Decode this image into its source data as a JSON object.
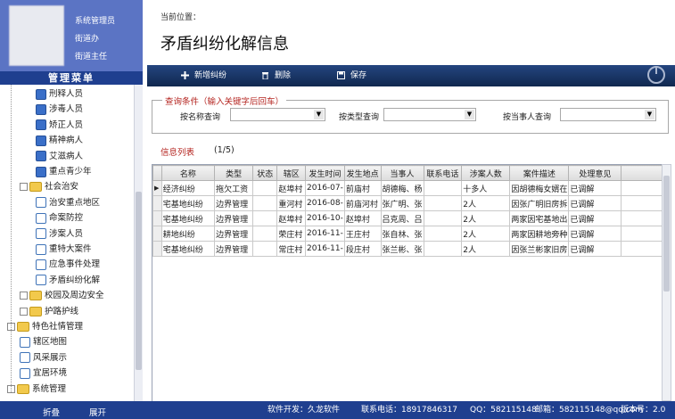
{
  "profile": {
    "roles": [
      "系统管理员",
      "街道办",
      "街道主任"
    ]
  },
  "menu": {
    "title": "管理菜单",
    "items": [
      {
        "label": "刑释人员",
        "level": 2,
        "icon": "person-icon"
      },
      {
        "label": "涉毒人员",
        "level": 2,
        "icon": "person-icon"
      },
      {
        "label": "矫正人员",
        "level": 2,
        "icon": "person-icon"
      },
      {
        "label": "精神病人",
        "level": 2,
        "icon": "person-icon"
      },
      {
        "label": "艾滋病人",
        "level": 2,
        "icon": "person-icon"
      },
      {
        "label": "重点青少年",
        "level": 2,
        "icon": "person-icon"
      },
      {
        "label": "社会治安",
        "level": 1,
        "icon": "folder-icon",
        "expander": "-"
      },
      {
        "label": "治安重点地区",
        "level": 2,
        "icon": "document-icon"
      },
      {
        "label": "命案防控",
        "level": 2,
        "icon": "document-icon"
      },
      {
        "label": "涉案人员",
        "level": 2,
        "icon": "document-icon"
      },
      {
        "label": "重特大案件",
        "level": 2,
        "icon": "document-icon"
      },
      {
        "label": "应急事件处理",
        "level": 2,
        "icon": "document-icon"
      },
      {
        "label": "矛盾纠纷化解",
        "level": 2,
        "icon": "document-icon"
      },
      {
        "label": "校园及周边安全",
        "level": 1,
        "icon": "folder-icon",
        "expander": "+"
      },
      {
        "label": "护路护线",
        "level": 1,
        "icon": "folder-icon",
        "expander": "+"
      },
      {
        "label": "特色社情管理",
        "level": 0,
        "icon": "folder-icon",
        "expander": "-"
      },
      {
        "label": "辖区地图",
        "level": 1,
        "icon": "map-icon"
      },
      {
        "label": "风采展示",
        "level": 1,
        "icon": "map-icon"
      },
      {
        "label": "宜居环境",
        "level": 1,
        "icon": "map-icon"
      },
      {
        "label": "系统管理",
        "level": 0,
        "icon": "folder-icon",
        "expander": "+"
      }
    ],
    "collapse_label": "折叠",
    "expand_label": "展开"
  },
  "breadcrumb": "当前位置：",
  "page_title": "矛盾纠纷化解信息",
  "toolbar": {
    "add_label": "新增纠纷",
    "delete_label": "删除",
    "save_label": "保存"
  },
  "query": {
    "legend": "查询条件（输入关键字后回车）",
    "filters": [
      {
        "label": "按名称查询",
        "value": ""
      },
      {
        "label": "按类型查询",
        "value": ""
      },
      {
        "label": "按当事人查询",
        "value": ""
      }
    ]
  },
  "list": {
    "title": "信息列表",
    "count": "(1/5)"
  },
  "table": {
    "columns": [
      "名称",
      "类型",
      "状态",
      "辖区",
      "发生时间",
      "发生地点",
      "当事人",
      "联系电话",
      "涉案人数",
      "案件描述",
      "处理意见"
    ],
    "rows": [
      [
        "经济纠纷",
        "拖欠工资",
        "",
        "赵埠村",
        "2016-07-",
        "前庙村",
        "胡德梅、杨",
        "",
        "十多人",
        "因胡德梅女婿在",
        "已调解"
      ],
      [
        "宅基地纠纷",
        "边界管理",
        "",
        "重河村",
        "2016-08-",
        "前庙河村",
        "张广明、张",
        "",
        "2人",
        "因张广明旧房拆",
        "已调解"
      ],
      [
        "宅基地纠纷",
        "边界管理",
        "",
        "赵埠村",
        "2016-10-",
        "赵埠村",
        "吕克周、吕",
        "",
        "2人",
        "两家因宅基地出",
        "已调解"
      ],
      [
        "耕地纠纷",
        "边界管理",
        "",
        "荣庄村",
        "2016-11-",
        "王庄村",
        "张自林、张",
        "",
        "2人",
        "两家因耕地旁种",
        "已调解"
      ],
      [
        "宅基地纠纷",
        "边界管理",
        "",
        "常庄村",
        "2016-11-",
        "段庄村",
        "张兰彬、张",
        "",
        "2人",
        "因张兰彬家旧房",
        "已调解"
      ]
    ],
    "current_row_marker": "▶"
  },
  "status": {
    "developer": "软件开发：久龙软件",
    "phone": "联系电话：18917846317",
    "qq": "QQ：582115148",
    "email": "邮箱：582115148@qq.com",
    "version": "版本号：2.0"
  },
  "colors": {
    "header_blue": "#1f3f8f",
    "profile_blue": "#5b74c4",
    "accent_red": "#b4241f"
  }
}
